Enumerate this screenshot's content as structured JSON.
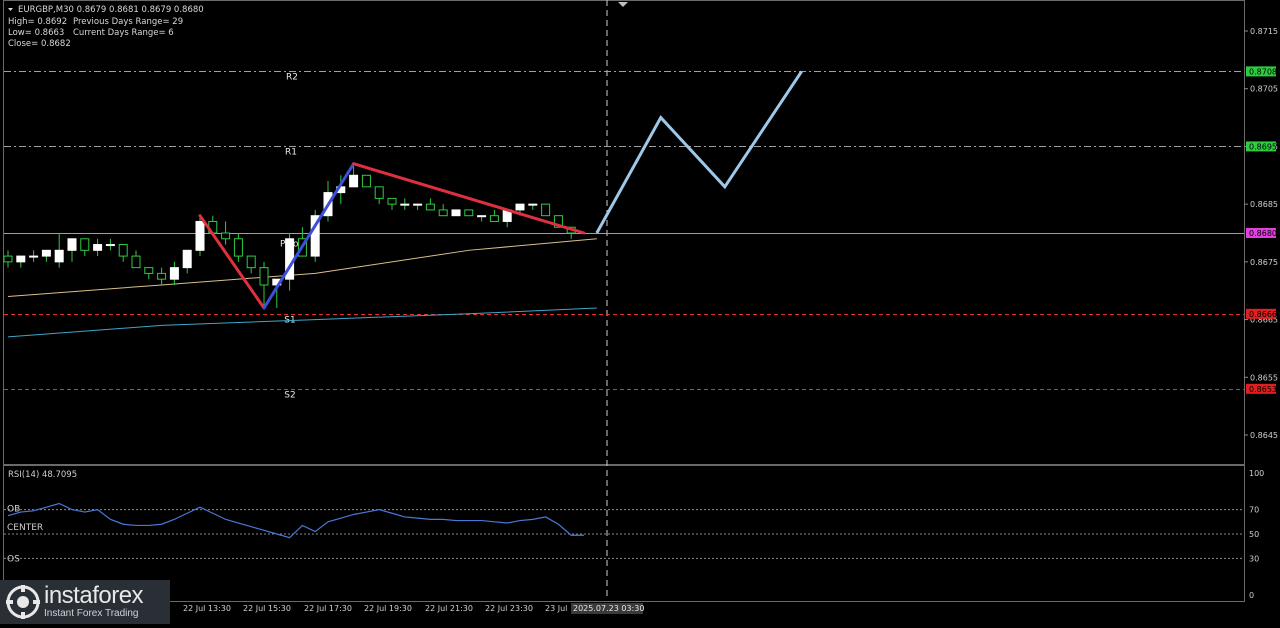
{
  "header": {
    "symbol_line": "EURGBP,M30  0.8679 0.8681 0.8679 0.8680",
    "info_lines": [
      [
        "High= 0.8692",
        "Previous Days Range= 29"
      ],
      [
        "Low= 0.8663",
        "Current Days Range= 6"
      ],
      [
        "Close= 0.8682",
        ""
      ]
    ]
  },
  "colors": {
    "background": "#000000",
    "bull_body": "#ffffff",
    "candle_outline": "#2ecc40",
    "support_line": "#e03030",
    "resist_line": "#a0a0a0",
    "zigzag_down": "#e03040",
    "zigzag_up": "#3b4fd8",
    "forecast": "#9fc8e8",
    "ma_fast": "#d8c08a",
    "ma_slow": "#3fa7c8",
    "rsi_line": "#4a78d8"
  },
  "chart_data": [
    {
      "type": "candlestick",
      "title": "EURGBP,M30",
      "ylim": [
        0.864,
        0.872
      ],
      "y_ticks": [
        "0.8715",
        "0.8705",
        "0.8695",
        "0.8685",
        "0.8675",
        "0.8665",
        "0.8655",
        "0.8645"
      ],
      "x_ticks": [
        "22 Jul 13:30",
        "22 Jul 15:30",
        "22 Jul 17:30",
        "22 Jul 19:30",
        "22 Jul 21:30",
        "22 Jul 23:30",
        "23 Jul"
      ],
      "x_partial_tick": "0",
      "time_cursor_label": "2025.07.23 03:30",
      "candles": [
        [
          0.8676,
          0.8677,
          0.8674,
          0.8675
        ],
        [
          0.8675,
          0.8676,
          0.8674,
          0.8676
        ],
        [
          0.8676,
          0.8677,
          0.8675,
          0.8676
        ],
        [
          0.8676,
          0.8677,
          0.8675,
          0.8677
        ],
        [
          0.8675,
          0.868,
          0.8674,
          0.8677
        ],
        [
          0.8677,
          0.8679,
          0.8675,
          0.8679
        ],
        [
          0.8679,
          0.8679,
          0.8676,
          0.8677
        ],
        [
          0.8677,
          0.8679,
          0.8676,
          0.8678
        ],
        [
          0.8678,
          0.8679,
          0.8677,
          0.8678
        ],
        [
          0.8678,
          0.8678,
          0.8675,
          0.8676
        ],
        [
          0.8676,
          0.8677,
          0.8674,
          0.8674
        ],
        [
          0.8674,
          0.8674,
          0.8672,
          0.8673
        ],
        [
          0.8673,
          0.8674,
          0.8671,
          0.8672
        ],
        [
          0.8672,
          0.8675,
          0.8671,
          0.8674
        ],
        [
          0.8674,
          0.8677,
          0.8673,
          0.8677
        ],
        [
          0.8677,
          0.8683,
          0.8676,
          0.8682
        ],
        [
          0.8682,
          0.8683,
          0.868,
          0.868
        ],
        [
          0.868,
          0.8682,
          0.8678,
          0.8679
        ],
        [
          0.8679,
          0.868,
          0.8675,
          0.8676
        ],
        [
          0.8676,
          0.8676,
          0.8673,
          0.8674
        ],
        [
          0.8674,
          0.8675,
          0.8667,
          0.8671
        ],
        [
          0.8671,
          0.8672,
          0.8667,
          0.8672
        ],
        [
          0.8672,
          0.868,
          0.867,
          0.8679
        ],
        [
          0.8679,
          0.8681,
          0.8676,
          0.8676
        ],
        [
          0.8676,
          0.8684,
          0.8675,
          0.8683
        ],
        [
          0.8683,
          0.8689,
          0.8682,
          0.8687
        ],
        [
          0.8687,
          0.869,
          0.8685,
          0.8688
        ],
        [
          0.8688,
          0.8692,
          0.8688,
          0.869
        ],
        [
          0.869,
          0.869,
          0.8688,
          0.8688
        ],
        [
          0.8688,
          0.8688,
          0.8685,
          0.8686
        ],
        [
          0.8686,
          0.8686,
          0.8684,
          0.8685
        ],
        [
          0.8685,
          0.8686,
          0.8684,
          0.8685
        ],
        [
          0.8685,
          0.8685,
          0.8684,
          0.8685
        ],
        [
          0.8685,
          0.8686,
          0.8684,
          0.8684
        ],
        [
          0.8684,
          0.8685,
          0.8683,
          0.8683
        ],
        [
          0.8683,
          0.8684,
          0.8683,
          0.8684
        ],
        [
          0.8684,
          0.8684,
          0.8683,
          0.8683
        ],
        [
          0.8683,
          0.8683,
          0.8682,
          0.8683
        ],
        [
          0.8683,
          0.8684,
          0.8682,
          0.8682
        ],
        [
          0.8682,
          0.8684,
          0.8681,
          0.8684
        ],
        [
          0.8684,
          0.8685,
          0.8683,
          0.8685
        ],
        [
          0.8685,
          0.8685,
          0.8684,
          0.8685
        ],
        [
          0.8685,
          0.8685,
          0.8683,
          0.8683
        ],
        [
          0.8683,
          0.8683,
          0.8681,
          0.8681
        ],
        [
          0.8681,
          0.8681,
          0.8679,
          0.868
        ]
      ],
      "pivot_lines": [
        {
          "label": "R2",
          "value": 0.8708,
          "tag": "0.8708",
          "tag_color": "#2ecc40",
          "line_color": "#a0a0a0"
        },
        {
          "label": "R1",
          "value": 0.8695,
          "tag": "0.8695",
          "tag_color": "#2ecc40",
          "line_color": "#a0a0a0"
        },
        {
          "label": "Pivot",
          "value": 0.868,
          "tag": "0.8680",
          "tag_color": "#e040e0",
          "line_color": "#b090c0"
        },
        {
          "label": "S1",
          "value": 0.8666,
          "tag": "0.8666",
          "tag_color": "#e02020",
          "line_color": "#e03030"
        },
        {
          "label": "S2",
          "value": 0.8653,
          "tag": "0.8653",
          "tag_color": "#e02020",
          "line_color": "#e03030"
        }
      ],
      "zigzag": [
        {
          "from": [
            15,
            0.8683
          ],
          "to": [
            20,
            0.8667
          ],
          "color": "down"
        },
        {
          "from": [
            20,
            0.8667
          ],
          "to": [
            27,
            0.8692
          ],
          "color": "up"
        },
        {
          "from": [
            27,
            0.8692
          ],
          "to": [
            45,
            0.868
          ],
          "color": "down"
        }
      ],
      "forecast_path": [
        [
          46,
          0.868
        ],
        [
          51,
          0.87
        ],
        [
          56,
          0.8688
        ],
        [
          62,
          0.8708
        ]
      ],
      "ma_fast": [
        [
          0,
          0.8669
        ],
        [
          12,
          0.8671
        ],
        [
          24,
          0.8673
        ],
        [
          36,
          0.8677
        ],
        [
          46,
          0.8679
        ]
      ],
      "ma_slow": [
        [
          0,
          0.8662
        ],
        [
          12,
          0.8664
        ],
        [
          24,
          0.8665
        ],
        [
          36,
          0.8666
        ],
        [
          46,
          0.8667
        ]
      ]
    },
    {
      "type": "line",
      "title": "RSI(14) 48.7095",
      "ylim": [
        0,
        100
      ],
      "y_ticks": [
        "100",
        "70",
        "50",
        "30",
        "0"
      ],
      "levels": [
        {
          "label": "OB",
          "value": 70
        },
        {
          "label": "CENTER",
          "value": 50
        },
        {
          "label": "OS",
          "value": 30
        }
      ],
      "values": [
        65,
        68,
        69,
        72,
        75,
        70,
        68,
        70,
        62,
        58,
        57,
        57,
        58,
        62,
        67,
        72,
        67,
        62,
        59,
        56,
        53,
        50,
        47,
        57,
        52,
        60,
        63,
        66,
        68,
        70,
        67,
        64,
        63,
        62,
        62,
        61,
        61,
        61,
        60,
        59,
        61,
        62,
        64,
        58,
        49,
        49
      ]
    }
  ],
  "watermark": {
    "brand": "instaforex",
    "tagline": "Instant Forex Trading"
  }
}
